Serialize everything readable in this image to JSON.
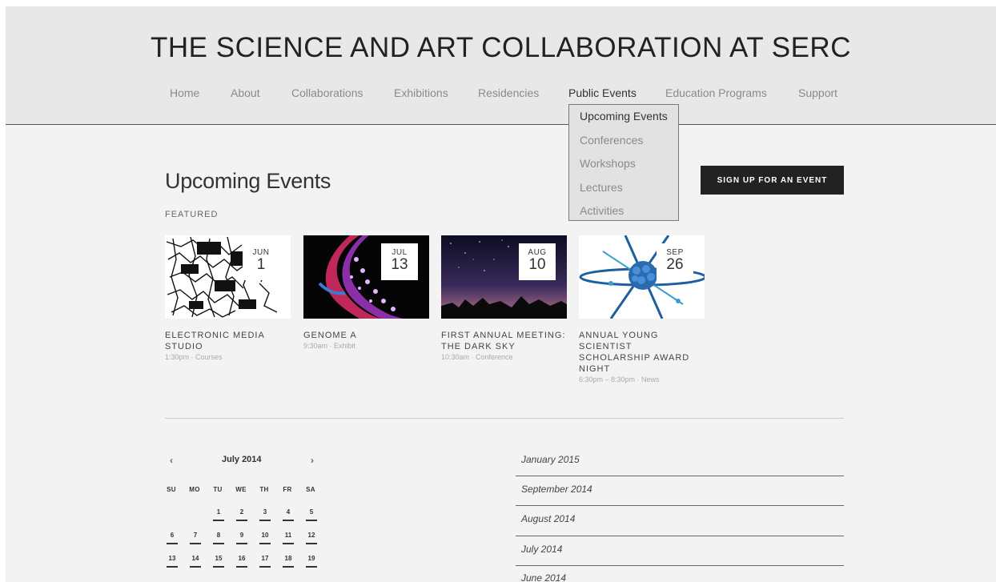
{
  "site": {
    "title": "THE SCIENCE AND ART COLLABORATION AT SERC"
  },
  "nav": {
    "items": [
      {
        "label": "Home"
      },
      {
        "label": "About"
      },
      {
        "label": "Collaborations"
      },
      {
        "label": "Exhibitions"
      },
      {
        "label": "Residencies"
      },
      {
        "label": "Public Events"
      },
      {
        "label": "Education Programs"
      },
      {
        "label": "Support"
      }
    ],
    "active": "Public Events",
    "dropdown": [
      {
        "label": "Upcoming Events"
      },
      {
        "label": "Conferences"
      },
      {
        "label": "Workshops"
      },
      {
        "label": "Lectures"
      },
      {
        "label": "Activities"
      }
    ]
  },
  "main": {
    "heading": "Upcoming Events",
    "featured_label": "FEATURED",
    "signup_label": "SIGN UP FOR AN EVENT",
    "events": [
      {
        "month": "JUN",
        "day": "1",
        "title": "ELECTRONIC MEDIA STUDIO",
        "meta": "1:30pm · Courses"
      },
      {
        "month": "JUL",
        "day": "13",
        "title": "GENOME A",
        "meta": "9:30am · Exhibit"
      },
      {
        "month": "AUG",
        "day": "10",
        "title": "FIRST ANNUAL MEETING: THE DARK SKY",
        "meta": "10:30am · Conference"
      },
      {
        "month": "SEP",
        "day": "26",
        "title": "ANNUAL YOUNG SCIENTIST SCHOLARSHIP AWARD NIGHT",
        "meta": "6:30pm – 8:30pm · News"
      }
    ]
  },
  "calendar": {
    "month_label": "July 2014",
    "prev_icon": "‹",
    "next_icon": "›",
    "weekdays": [
      "SU",
      "MO",
      "TU",
      "WE",
      "TH",
      "FR",
      "SA"
    ],
    "weeks": [
      [
        "",
        "",
        "1",
        "2",
        "3",
        "4",
        "5"
      ],
      [
        "6",
        "7",
        "8",
        "9",
        "10",
        "11",
        "12"
      ],
      [
        "13",
        "14",
        "15",
        "16",
        "17",
        "18",
        "19"
      ]
    ]
  },
  "archive": {
    "months": [
      "January 2015",
      "September 2014",
      "August 2014",
      "July 2014",
      "June 2014"
    ]
  }
}
